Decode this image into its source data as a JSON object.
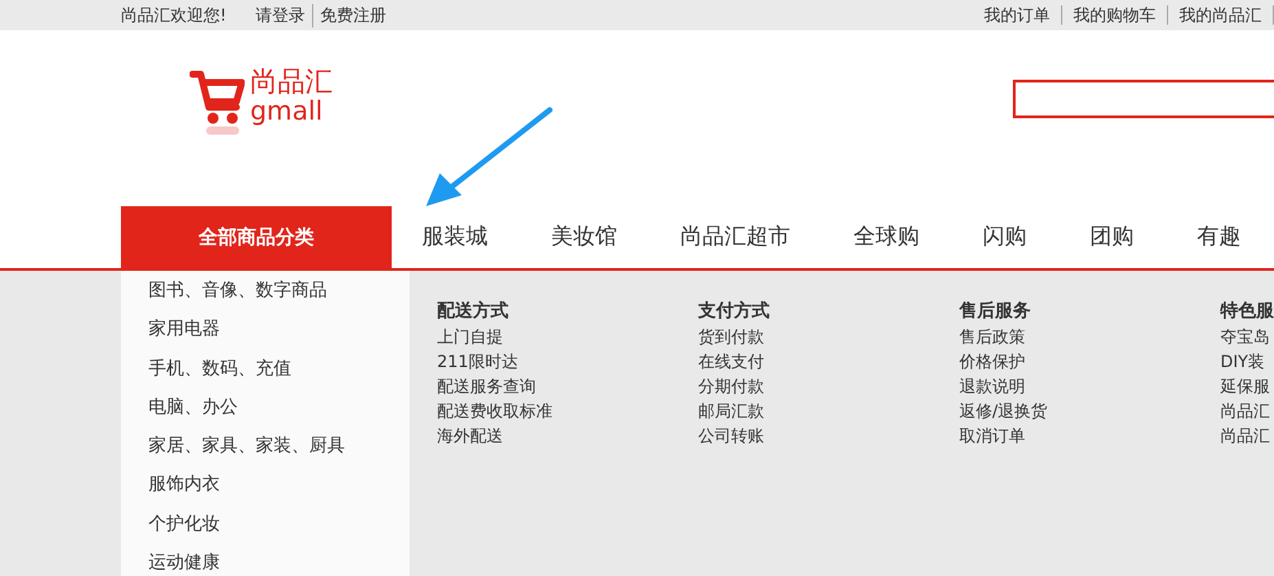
{
  "top_bar": {
    "welcome": "尚品汇欢迎您!",
    "login": "请登录",
    "register": "免费注册",
    "links": [
      "我的订单",
      "我的购物车",
      "我的尚品汇"
    ]
  },
  "logo": {
    "name": "尚品汇",
    "subname": "gmall"
  },
  "nav": {
    "all_categories": "全部商品分类",
    "items": [
      "服装城",
      "美妆馆",
      "尚品汇超市",
      "全球购",
      "闪购",
      "团购",
      "有趣"
    ]
  },
  "categories": [
    "图书、音像、数字商品",
    "家用电器",
    "手机、数码、充值",
    "电脑、办公",
    "家居、家具、家装、厨具",
    "服饰内衣",
    "个护化妆",
    "运动健康"
  ],
  "service_columns": [
    {
      "title": "配送方式",
      "links": [
        "上门自提",
        "211限时达",
        "配送服务查询",
        "配送费收取标准",
        "海外配送"
      ]
    },
    {
      "title": "支付方式",
      "links": [
        "货到付款",
        "在线支付",
        "分期付款",
        "邮局汇款",
        "公司转账"
      ]
    },
    {
      "title": "售后服务",
      "links": [
        "售后政策",
        "价格保护",
        "退款说明",
        "返修/退换货",
        "取消订单"
      ]
    },
    {
      "title": "特色服",
      "links": [
        "夺宝岛",
        "DIY装",
        "延保服",
        "尚品汇",
        "尚品汇"
      ]
    }
  ]
}
